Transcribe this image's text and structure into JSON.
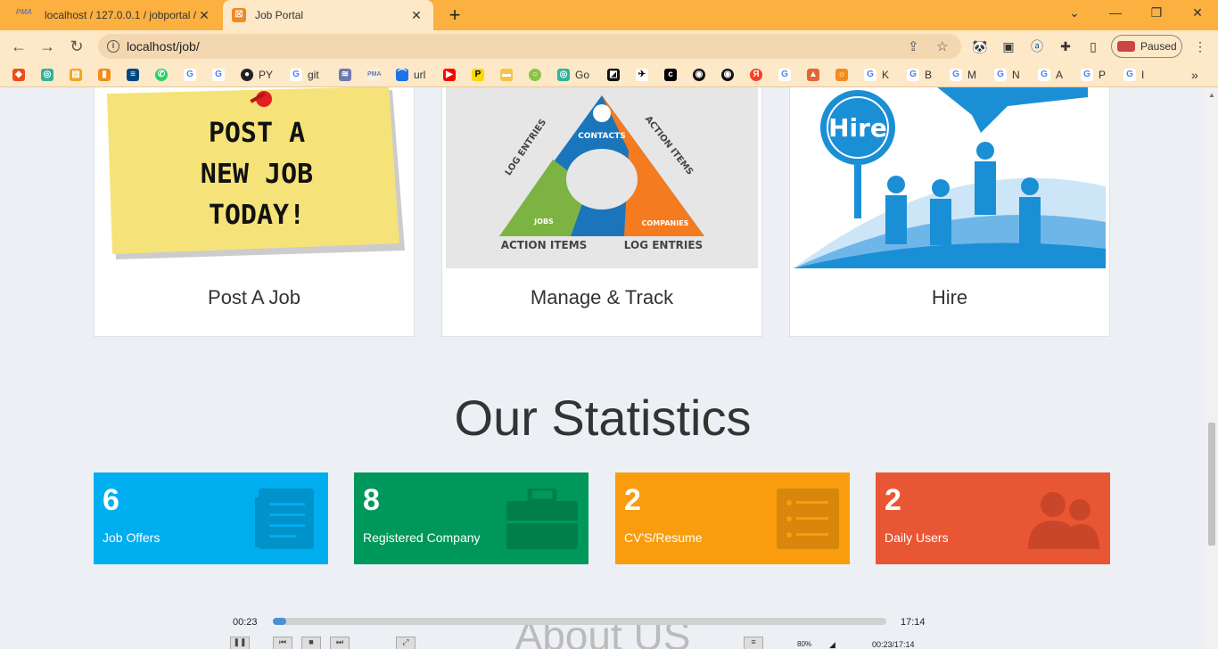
{
  "browser": {
    "tabs": [
      {
        "title": "localhost / 127.0.0.1 / jobportal /",
        "favicon": "phpmyadmin-icon"
      },
      {
        "title": "Job Portal",
        "favicon": "job-portal-icon"
      }
    ],
    "address": "localhost/job/",
    "profile_label": "Paused",
    "bookmarks": [
      "PY",
      "git",
      "url",
      "Go",
      "K",
      "B",
      "M",
      "N",
      "A",
      "P",
      "I"
    ]
  },
  "cards": [
    {
      "label": "Post A Job",
      "image_text": [
        "POST A",
        "NEW JOB",
        "TODAY!"
      ]
    },
    {
      "label": "Manage & Track",
      "image_text": [
        "CONTACTS",
        "ACTION ITEMS",
        "LOG ENTRIES",
        "JOBS",
        "COMPANIES",
        "ACTION ITEMS",
        "LOG ENTRIES"
      ]
    },
    {
      "label": "Hire",
      "image_text": [
        "Hire"
      ]
    }
  ],
  "statistics": {
    "title": "Our Statistics",
    "items": [
      {
        "value": "6",
        "label": "Job Offers",
        "color": "#00aeef",
        "icon": "document-icon"
      },
      {
        "value": "8",
        "label": "Registered Company",
        "color": "#00985a",
        "icon": "briefcase-icon"
      },
      {
        "value": "2",
        "label": "CV'S/Resume",
        "color": "#f99d0e",
        "icon": "list-icon"
      },
      {
        "value": "2",
        "label": "Daily Users",
        "color": "#e85634",
        "icon": "users-icon"
      }
    ]
  },
  "about_title": "About US",
  "player": {
    "current": "00:23",
    "total": "17:14",
    "progress": 0.022,
    "zoom": "80%",
    "readout": "00:23/17:14"
  }
}
